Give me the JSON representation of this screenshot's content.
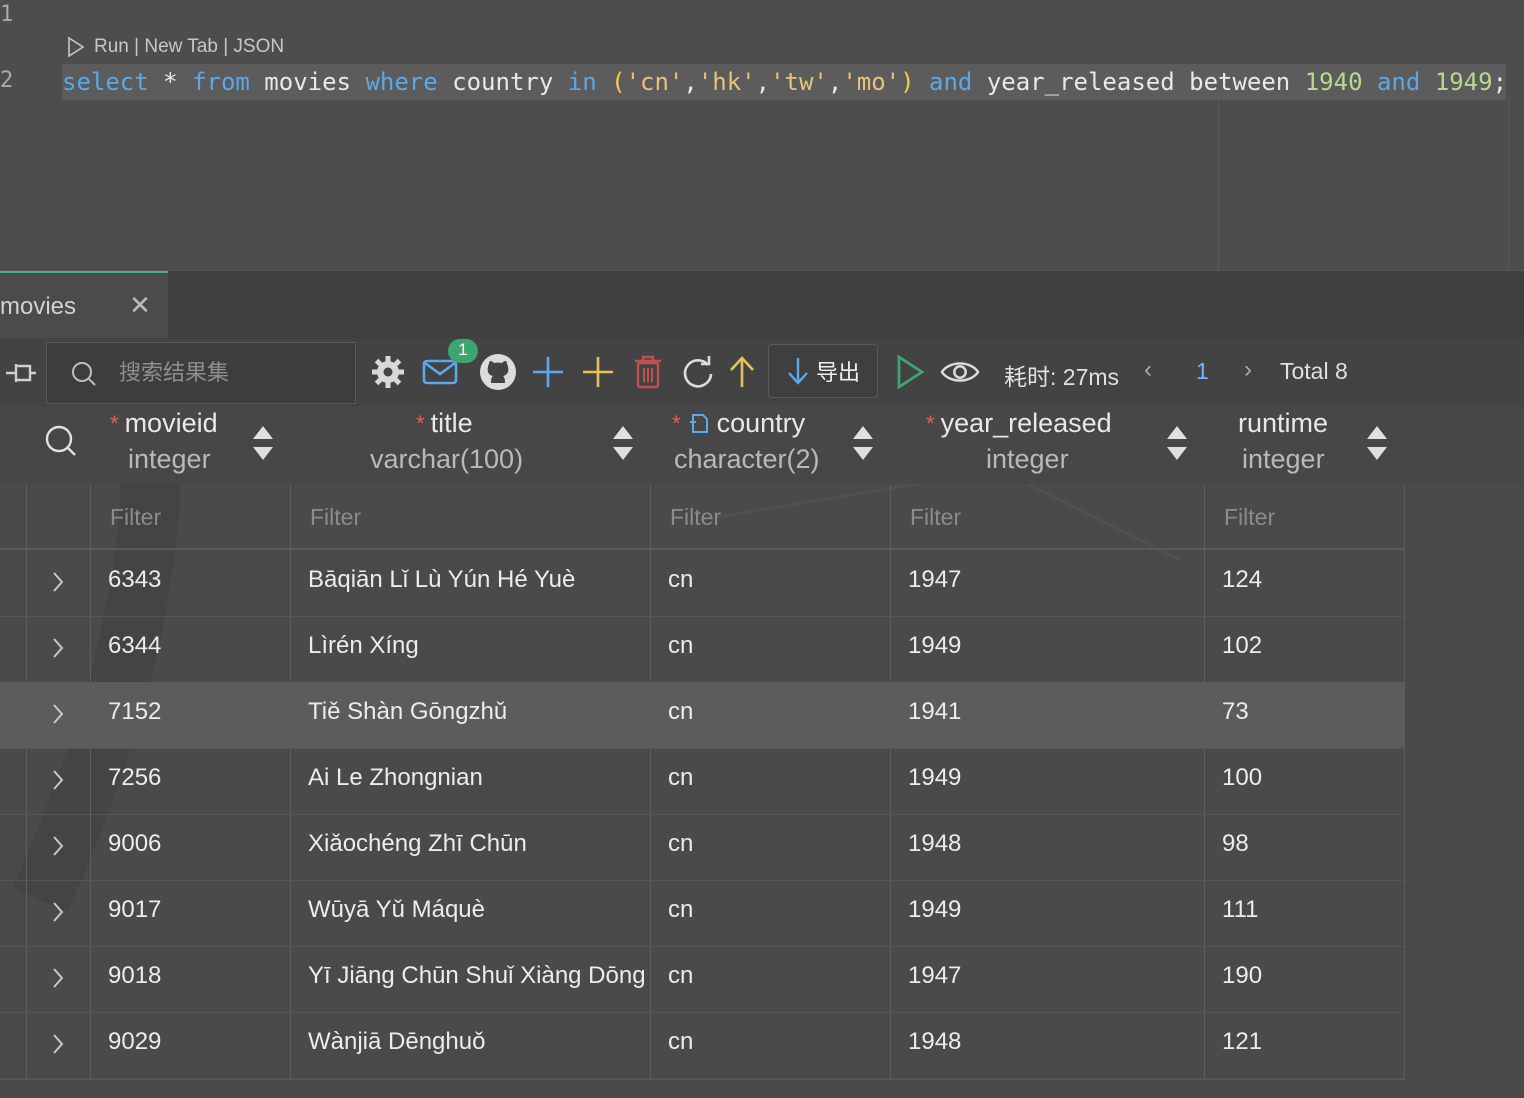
{
  "editor": {
    "line_numbers": [
      "1",
      "2"
    ],
    "codelens": "Run | New Tab | JSON",
    "sql_tokens": [
      {
        "t": "select",
        "c": "kw"
      },
      {
        "t": " * ",
        "c": ""
      },
      {
        "t": "from",
        "c": "kw"
      },
      {
        "t": " movies ",
        "c": ""
      },
      {
        "t": "where",
        "c": "kw"
      },
      {
        "t": " country ",
        "c": ""
      },
      {
        "t": "in",
        "c": "kw"
      },
      {
        "t": " ",
        "c": ""
      },
      {
        "t": "(",
        "c": "paren"
      },
      {
        "t": "'cn'",
        "c": "str"
      },
      {
        "t": ",",
        "c": ""
      },
      {
        "t": "'hk'",
        "c": "str"
      },
      {
        "t": ",",
        "c": ""
      },
      {
        "t": "'tw'",
        "c": "str"
      },
      {
        "t": ",",
        "c": ""
      },
      {
        "t": "'mo'",
        "c": "str"
      },
      {
        "t": ")",
        "c": "paren"
      },
      {
        "t": " ",
        "c": ""
      },
      {
        "t": "and",
        "c": "kw"
      },
      {
        "t": " year_released between ",
        "c": ""
      },
      {
        "t": "1940",
        "c": "num"
      },
      {
        "t": " ",
        "c": ""
      },
      {
        "t": "and",
        "c": "kw"
      },
      {
        "t": " ",
        "c": ""
      },
      {
        "t": "1949",
        "c": "num"
      },
      {
        "t": ";",
        "c": ""
      }
    ]
  },
  "tab": {
    "label": "movies",
    "close_glyph": "✕"
  },
  "toolbar": {
    "search_placeholder": "搜索结果集",
    "badge_count": "1",
    "export_label": "导出",
    "elapsed": "耗时: 27ms",
    "page_current": "1",
    "total": "Total 8"
  },
  "columns": [
    {
      "name": "movieid",
      "type": "integer",
      "required": true
    },
    {
      "name": "title",
      "type": "varchar(100)",
      "required": true
    },
    {
      "name": "country",
      "type": "character(2)",
      "required": true,
      "foreign_key": true
    },
    {
      "name": "year_released",
      "type": "integer",
      "required": true
    },
    {
      "name": "runtime",
      "type": "integer",
      "required": false
    }
  ],
  "filter_placeholder": "Filter",
  "rows": [
    {
      "movieid": "6343",
      "title": "Bāqiān Lǐ Lù Yún Hé Yuè",
      "country": "cn",
      "year_released": "1947",
      "runtime": "124"
    },
    {
      "movieid": "6344",
      "title": "Lìrén Xíng",
      "country": "cn",
      "year_released": "1949",
      "runtime": "102"
    },
    {
      "movieid": "7152",
      "title": "Tiě Shàn Gōngzhǔ",
      "country": "cn",
      "year_released": "1941",
      "runtime": "73"
    },
    {
      "movieid": "7256",
      "title": "Ai Le Zhongnian",
      "country": "cn",
      "year_released": "1949",
      "runtime": "100"
    },
    {
      "movieid": "9006",
      "title": "Xiǎochéng Zhī Chūn",
      "country": "cn",
      "year_released": "1948",
      "runtime": "98"
    },
    {
      "movieid": "9017",
      "title": "Wūyā Yǔ Máquè",
      "country": "cn",
      "year_released": "1949",
      "runtime": "111"
    },
    {
      "movieid": "9018",
      "title": "Yī Jiāng Chūn Shuǐ Xiàng Dōng Liú",
      "country": "cn",
      "year_released": "1947",
      "runtime": "190"
    },
    {
      "movieid": "9029",
      "title": "Wànjiā Dēnghuǒ",
      "country": "cn",
      "year_released": "1948",
      "runtime": "121"
    }
  ],
  "highlighted_row": 2,
  "colors": {
    "accent_green": "#3ea56f",
    "pager_blue": "#6fb7ff",
    "keyword_blue": "#5aa8e8",
    "string_yellow": "#e8c27a"
  }
}
